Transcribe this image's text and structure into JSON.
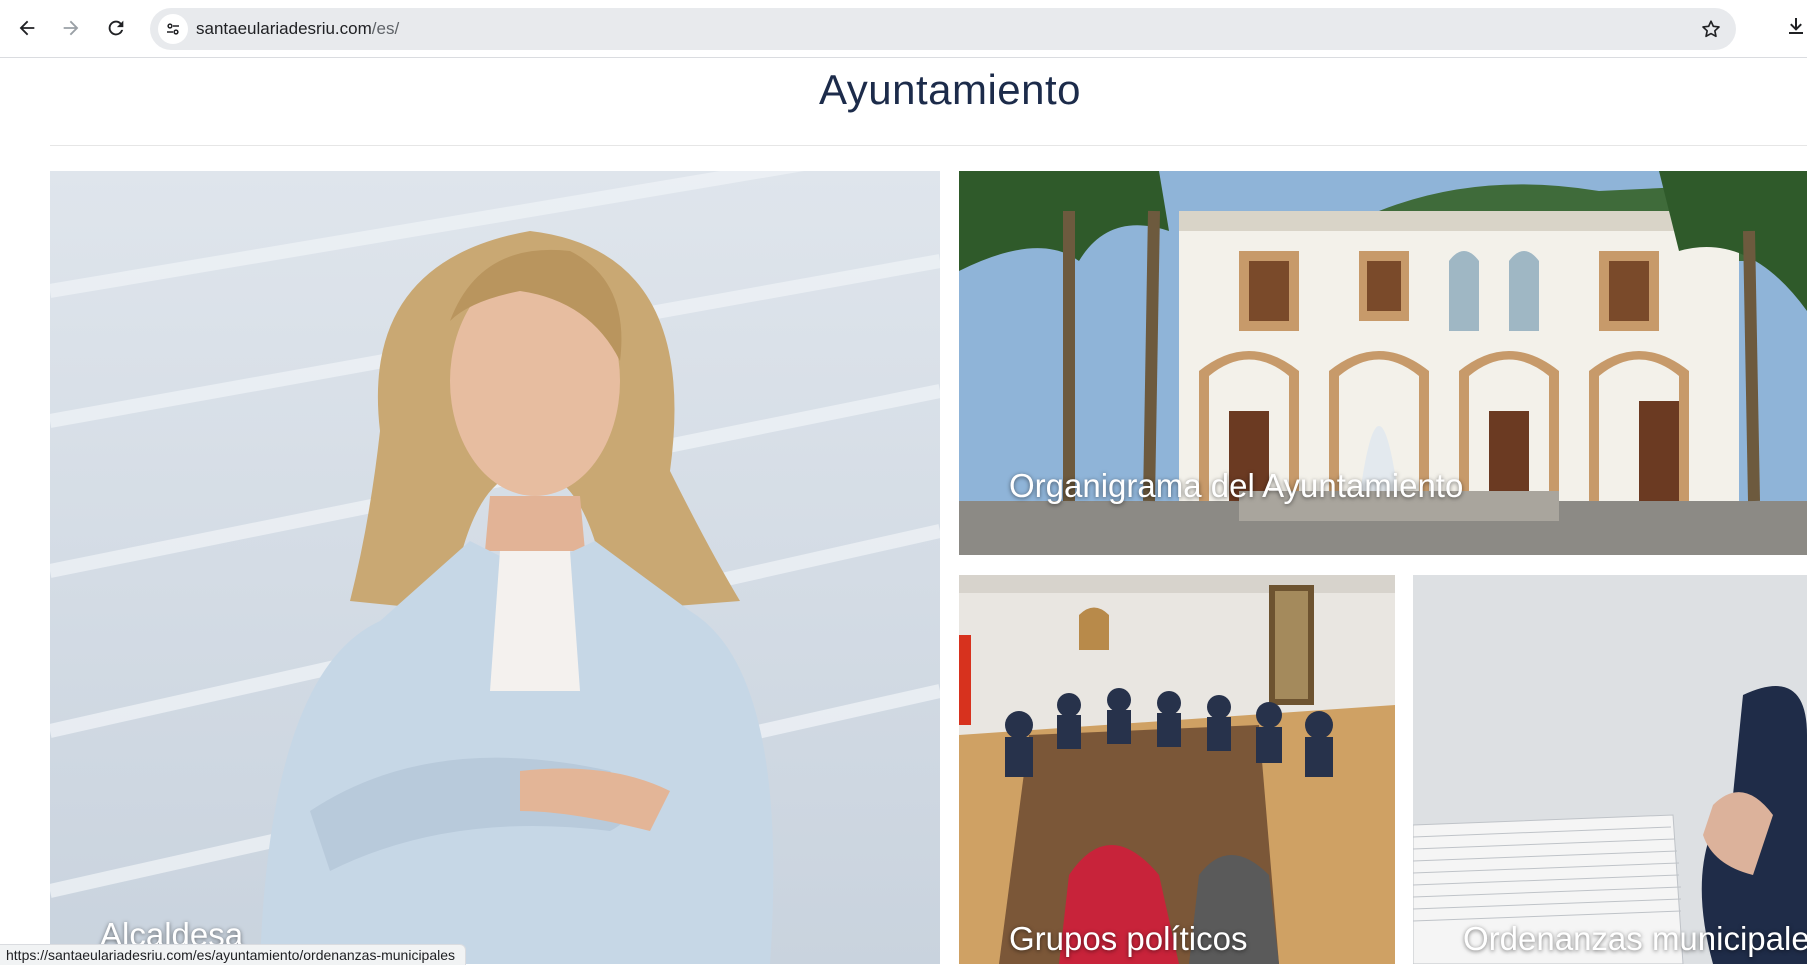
{
  "browser": {
    "url_host": "santaeulariadesriu.com",
    "url_path": "/es/",
    "back_icon": "arrow-left-icon",
    "forward_icon": "arrow-right-icon",
    "reload_icon": "reload-icon",
    "site_info_icon": "tune-icon",
    "bookmark_icon": "star-icon",
    "download_icon": "download-icon"
  },
  "page": {
    "title": "Ayuntamiento"
  },
  "tiles": {
    "alcaldesa": {
      "label": "Alcaldesa"
    },
    "organigrama": {
      "label": "Organigrama del Ayuntamiento"
    },
    "grupos": {
      "label": "Grupos políticos"
    },
    "ordenanzas": {
      "label": "Ordenanzas municipales"
    }
  },
  "status_bar": {
    "link_url": "https://santaeulariadesriu.com/es/ayuntamiento/ordenanzas-municipales"
  },
  "colors": {
    "title": "#1c2b4a",
    "omnibox": "#e8eaed",
    "label_text": "#ffffff"
  }
}
